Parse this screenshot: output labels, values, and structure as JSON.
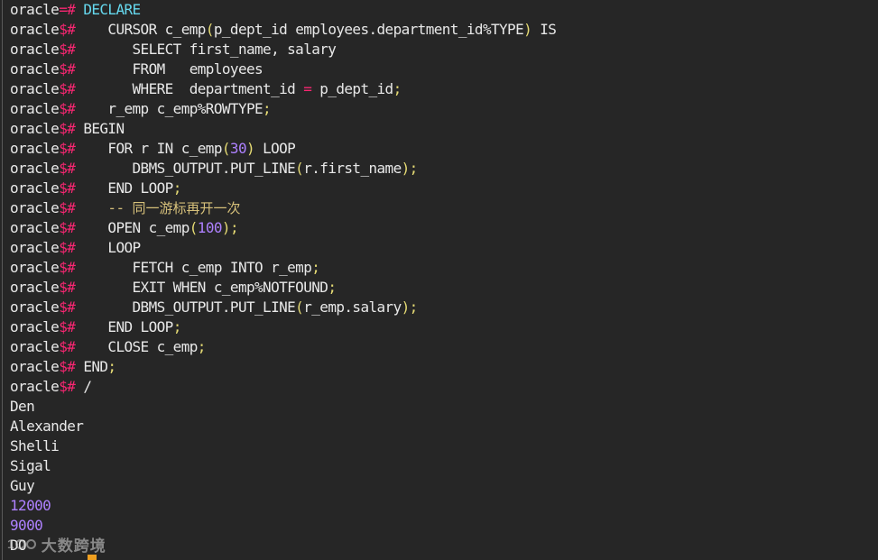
{
  "terminal": {
    "lines": [
      [
        {
          "t": "oracle",
          "c": "prompt"
        },
        {
          "t": "=#",
          "c": "pink"
        },
        {
          "t": " ",
          "c": "text"
        },
        {
          "t": "DECLARE",
          "c": "cyan"
        }
      ],
      [
        {
          "t": "oracle",
          "c": "prompt"
        },
        {
          "t": "$#",
          "c": "pink"
        },
        {
          "t": "    CURSOR c_emp",
          "c": "text"
        },
        {
          "t": "(",
          "c": "yellow"
        },
        {
          "t": "p_dept_id employees.department_id%TYPE",
          "c": "text"
        },
        {
          "t": ")",
          "c": "yellow"
        },
        {
          "t": " IS",
          "c": "text"
        }
      ],
      [
        {
          "t": "oracle",
          "c": "prompt"
        },
        {
          "t": "$#",
          "c": "pink"
        },
        {
          "t": "       SELECT first_name, salary",
          "c": "text"
        }
      ],
      [
        {
          "t": "oracle",
          "c": "prompt"
        },
        {
          "t": "$#",
          "c": "pink"
        },
        {
          "t": "       FROM   employees",
          "c": "text"
        }
      ],
      [
        {
          "t": "oracle",
          "c": "prompt"
        },
        {
          "t": "$#",
          "c": "pink"
        },
        {
          "t": "       WHERE  department_id ",
          "c": "text"
        },
        {
          "t": "=",
          "c": "pink"
        },
        {
          "t": " p_dept_id",
          "c": "text"
        },
        {
          "t": ";",
          "c": "yellow"
        }
      ],
      [
        {
          "t": "oracle",
          "c": "prompt"
        },
        {
          "t": "$#",
          "c": "pink"
        },
        {
          "t": "    r_emp c_emp%ROWTYPE",
          "c": "text"
        },
        {
          "t": ";",
          "c": "yellow"
        }
      ],
      [
        {
          "t": "oracle",
          "c": "prompt"
        },
        {
          "t": "$#",
          "c": "pink"
        },
        {
          "t": " BEGIN",
          "c": "text"
        }
      ],
      [
        {
          "t": "oracle",
          "c": "prompt"
        },
        {
          "t": "$#",
          "c": "pink"
        },
        {
          "t": "    FOR r IN c_emp",
          "c": "text"
        },
        {
          "t": "(",
          "c": "yellow"
        },
        {
          "t": "30",
          "c": "num"
        },
        {
          "t": ")",
          "c": "yellow"
        },
        {
          "t": " LOOP",
          "c": "text"
        }
      ],
      [
        {
          "t": "oracle",
          "c": "prompt"
        },
        {
          "t": "$#",
          "c": "pink"
        },
        {
          "t": "       DBMS_OUTPUT.PUT_LINE",
          "c": "text"
        },
        {
          "t": "(",
          "c": "yellow"
        },
        {
          "t": "r.first_name",
          "c": "text"
        },
        {
          "t": ");",
          "c": "yellow"
        }
      ],
      [
        {
          "t": "oracle",
          "c": "prompt"
        },
        {
          "t": "$#",
          "c": "pink"
        },
        {
          "t": "    END LOOP",
          "c": "text"
        },
        {
          "t": ";",
          "c": "yellow"
        }
      ],
      [
        {
          "t": "oracle",
          "c": "prompt"
        },
        {
          "t": "$#",
          "c": "pink"
        },
        {
          "t": "    -- ",
          "c": "comment"
        },
        {
          "t": "同一游标再开一次",
          "c": "comment-cjk"
        }
      ],
      [
        {
          "t": "oracle",
          "c": "prompt"
        },
        {
          "t": "$#",
          "c": "pink"
        },
        {
          "t": "    OPEN c_emp",
          "c": "text"
        },
        {
          "t": "(",
          "c": "yellow"
        },
        {
          "t": "100",
          "c": "num"
        },
        {
          "t": ");",
          "c": "yellow"
        }
      ],
      [
        {
          "t": "oracle",
          "c": "prompt"
        },
        {
          "t": "$#",
          "c": "pink"
        },
        {
          "t": "    LOOP",
          "c": "text"
        }
      ],
      [
        {
          "t": "oracle",
          "c": "prompt"
        },
        {
          "t": "$#",
          "c": "pink"
        },
        {
          "t": "       FETCH c_emp INTO r_emp",
          "c": "text"
        },
        {
          "t": ";",
          "c": "yellow"
        }
      ],
      [
        {
          "t": "oracle",
          "c": "prompt"
        },
        {
          "t": "$#",
          "c": "pink"
        },
        {
          "t": "       EXIT WHEN c_emp%NOTFOUND",
          "c": "text"
        },
        {
          "t": ";",
          "c": "yellow"
        }
      ],
      [
        {
          "t": "oracle",
          "c": "prompt"
        },
        {
          "t": "$#",
          "c": "pink"
        },
        {
          "t": "       DBMS_OUTPUT.PUT_LINE",
          "c": "text"
        },
        {
          "t": "(",
          "c": "yellow"
        },
        {
          "t": "r_emp.salary",
          "c": "text"
        },
        {
          "t": ");",
          "c": "yellow"
        }
      ],
      [
        {
          "t": "oracle",
          "c": "prompt"
        },
        {
          "t": "$#",
          "c": "pink"
        },
        {
          "t": "    END LOOP",
          "c": "text"
        },
        {
          "t": ";",
          "c": "yellow"
        }
      ],
      [
        {
          "t": "oracle",
          "c": "prompt"
        },
        {
          "t": "$#",
          "c": "pink"
        },
        {
          "t": "    CLOSE c_emp",
          "c": "text"
        },
        {
          "t": ";",
          "c": "yellow"
        }
      ],
      [
        {
          "t": "oracle",
          "c": "prompt"
        },
        {
          "t": "$#",
          "c": "pink"
        },
        {
          "t": " END",
          "c": "text"
        },
        {
          "t": ";",
          "c": "yellow"
        }
      ],
      [
        {
          "t": "oracle",
          "c": "prompt"
        },
        {
          "t": "$#",
          "c": "pink"
        },
        {
          "t": " /",
          "c": "text"
        }
      ],
      [
        {
          "t": "Den",
          "c": "text"
        }
      ],
      [
        {
          "t": "Alexander",
          "c": "text"
        }
      ],
      [
        {
          "t": "Shelli",
          "c": "text"
        }
      ],
      [
        {
          "t": "Sigal",
          "c": "text"
        }
      ],
      [
        {
          "t": "Guy",
          "c": "text"
        }
      ],
      [
        {
          "t": "12000",
          "c": "num"
        }
      ],
      [
        {
          "t": "9000",
          "c": "num"
        }
      ],
      [
        {
          "t": "DO",
          "c": "text"
        }
      ]
    ]
  },
  "watermark": {
    "logo_text": "1",
    "text": "大数跨境"
  },
  "colors": {
    "background": "#262626",
    "text": "#e8e8e8",
    "prompt_symbol": "#f92672",
    "keyword": "#66d9ef",
    "punctuation": "#e6db74",
    "number": "#ae81ff",
    "comment": "#d6c07a",
    "cursor": "#f0a020"
  }
}
